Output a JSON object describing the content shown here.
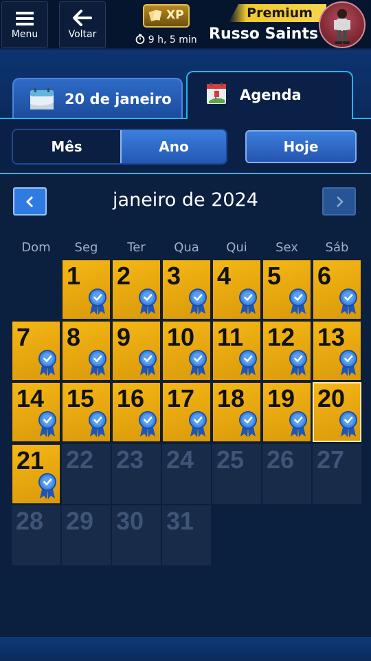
{
  "topbar": {
    "menu_label": "Menu",
    "back_label": "Voltar",
    "xp_label": "XP",
    "timer_text": "9 h, 5 min",
    "premium_label": "Premium",
    "username": "Russo Saints"
  },
  "tabs": {
    "date_label": "20 de janeiro",
    "agenda_label": "Agenda"
  },
  "controls": {
    "month_label": "Mês",
    "year_label": "Ano",
    "today_label": "Hoje",
    "selected": "Ano"
  },
  "calendar": {
    "title": "janeiro de 2024",
    "weekdays": [
      "Dom",
      "Seg",
      "Ter",
      "Qua",
      "Qui",
      "Sex",
      "Sáb"
    ],
    "first_weekday_index": 1,
    "days_in_month": 31,
    "completed_days": [
      1,
      2,
      3,
      4,
      5,
      6,
      7,
      8,
      9,
      10,
      11,
      12,
      13,
      14,
      15,
      16,
      17,
      18,
      19,
      20,
      21
    ],
    "today": 20,
    "colors": {
      "completed": "#f0b414",
      "future": "#182c4a",
      "badge": "#2a6fd8"
    }
  },
  "icons": {
    "menu": "hamburger-icon",
    "back": "arrow-left-icon",
    "timer": "stopwatch-icon",
    "prev": "chevron-left-icon",
    "next": "chevron-right-icon",
    "badge": "ribbon-check-icon",
    "date_tab": "calendar-page-icon",
    "agenda_tab": "calendar-agenda-icon"
  }
}
